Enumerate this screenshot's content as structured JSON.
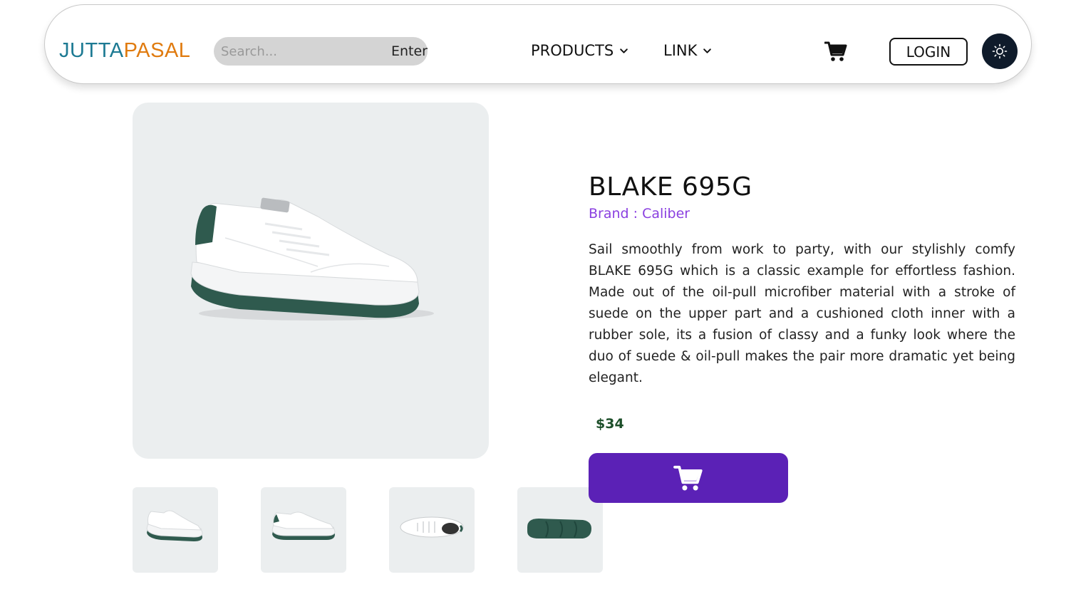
{
  "navbar": {
    "logo_part1": "JUTTA",
    "logo_part2": "PASAL",
    "search_placeholder": "Search...",
    "search_enter_label": "Enter",
    "menu": [
      {
        "label": "PRODUCTS"
      },
      {
        "label": "LINK"
      }
    ],
    "cart_icon": "shopping-cart-icon",
    "login_label": "LOGIN",
    "theme_icon": "sun-icon"
  },
  "product": {
    "title": "BLAKE 695G",
    "brand": "Brand : Caliber",
    "description": "Sail smoothly from work to party, with our stylishly comfy BLAKE 695G which is a classic example for effortless fashion. Made out of the oil-pull microfiber material with a stroke of suede on the upper part and a cushioned cloth inner with a rubber sole, its a fusion of classy and a funky look where the duo of suede & oil-pull makes the pair more dramatic yet being elegant.",
    "price": "$34",
    "add_to_cart_icon": "shopping-cart-icon",
    "thumbnails": [
      "side-view",
      "side-view-2",
      "top-view",
      "sole-view"
    ]
  },
  "colors": {
    "logo_blue": "#1d7a93",
    "logo_orange": "#e07b0f",
    "brand_purple": "#8a3fe0",
    "price_green": "#1d4f2a",
    "cart_button": "#5b21b6",
    "theme_button": "#0f1b2b",
    "image_bg": "#ebeeef"
  }
}
